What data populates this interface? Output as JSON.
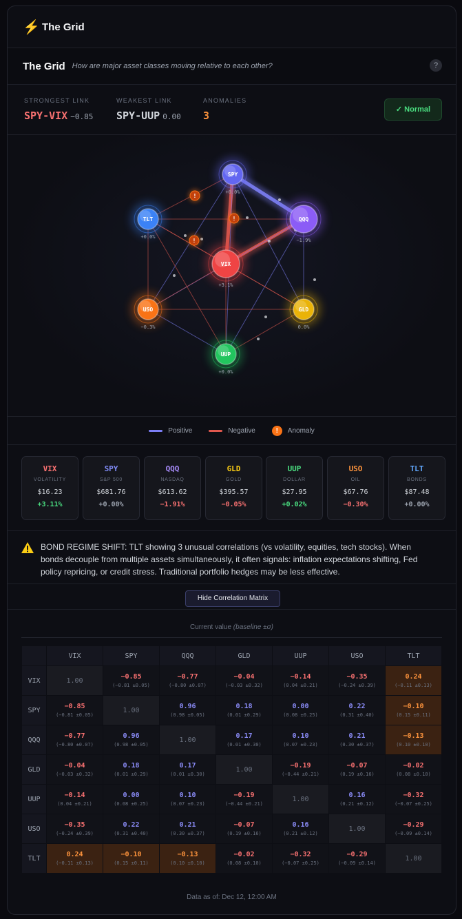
{
  "app": {
    "title": "The Grid",
    "icon": "lightning-bolt-icon"
  },
  "header": {
    "title": "The Grid",
    "subtitle": "How are major asset classes moving relative to each other?",
    "help": "?"
  },
  "stats": {
    "strongest": {
      "label": "STRONGEST LINK",
      "pair": "SPY-VIX",
      "value": "−0.85"
    },
    "weakest": {
      "label": "WEAKEST LINK",
      "pair": "SPY-UUP",
      "value": "0.00"
    },
    "anomalies": {
      "label": "ANOMALIES",
      "value": "3"
    },
    "status": "✓  Normal"
  },
  "colors": {
    "positive": "#7c7ff5",
    "negative": "#e0584e",
    "anomaly": "#f97316"
  },
  "nodes": [
    {
      "id": "SPY",
      "change": "+0.0%",
      "color": "#6366f1"
    },
    {
      "id": "QQQ",
      "change": "−1.9%",
      "color": "#8b5cf6"
    },
    {
      "id": "TLT",
      "change": "+0.0%",
      "color": "#3b82f6"
    },
    {
      "id": "VIX",
      "change": "+3.1%",
      "color": "#ef4444"
    },
    {
      "id": "USO",
      "change": "−0.3%",
      "color": "#f97316"
    },
    {
      "id": "GLD",
      "change": "0.0%",
      "color": "#eab308"
    },
    {
      "id": "UUP",
      "change": "+0.0%",
      "color": "#22c55e"
    }
  ],
  "legend": {
    "positive": "Positive",
    "negative": "Negative",
    "anomaly": "Anomaly",
    "anomaly_mark": "!"
  },
  "assets": [
    {
      "symbol": "VIX",
      "name": "VOLATILITY",
      "price": "$16.23",
      "change": "+3.11%",
      "color": "#f87171",
      "dir": "up"
    },
    {
      "symbol": "SPY",
      "name": "S&P 500",
      "price": "$681.76",
      "change": "+0.00%",
      "color": "#818cf8",
      "dir": "flat"
    },
    {
      "symbol": "QQQ",
      "name": "NASDAQ",
      "price": "$613.62",
      "change": "−1.91%",
      "color": "#a78bfa",
      "dir": "down"
    },
    {
      "symbol": "GLD",
      "name": "GOLD",
      "price": "$395.57",
      "change": "−0.05%",
      "color": "#facc15",
      "dir": "down"
    },
    {
      "symbol": "UUP",
      "name": "DOLLAR",
      "price": "$27.95",
      "change": "+0.02%",
      "color": "#4ade80",
      "dir": "up"
    },
    {
      "symbol": "USO",
      "name": "OIL",
      "price": "$67.76",
      "change": "−0.30%",
      "color": "#fb923c",
      "dir": "down"
    },
    {
      "symbol": "TLT",
      "name": "BONDS",
      "price": "$87.48",
      "change": "+0.00%",
      "color": "#60a5fa",
      "dir": "flat"
    }
  ],
  "alert": {
    "text": "BOND REGIME SHIFT: TLT showing 3 unusual correlations (vs volatility, equities, tech stocks). When bonds decouple from multiple assets simultaneously, it often signals: inflation expectations shifting, Fed policy repricing, or credit stress. Traditional portfolio hedges may be less effective."
  },
  "matrix_toggle": "Hide Correlation Matrix",
  "matrix": {
    "caption": "Current value",
    "caption_note": "(baseline ±σ)",
    "labels": [
      "VIX",
      "SPY",
      "QQQ",
      "GLD",
      "UUP",
      "USO",
      "TLT"
    ],
    "rows": [
      [
        {
          "v": "1.00",
          "d": 1
        },
        {
          "v": "−0.85",
          "b": "(−0.81 ±0.05)"
        },
        {
          "v": "−0.77",
          "b": "(−0.80 ±0.07)"
        },
        {
          "v": "−0.04",
          "b": "(−0.03 ±0.32)"
        },
        {
          "v": "−0.14",
          "b": "(0.04 ±0.21)"
        },
        {
          "v": "−0.35",
          "b": "(−0.24 ±0.39)"
        },
        {
          "v": "0.24",
          "b": "(−0.11 ±0.13)",
          "a": 1
        }
      ],
      [
        {
          "v": "−0.85",
          "b": "(−0.81 ±0.05)"
        },
        {
          "v": "1.00",
          "d": 1
        },
        {
          "v": "0.96",
          "b": "(0.98 ±0.05)"
        },
        {
          "v": "0.18",
          "b": "(0.01 ±0.29)"
        },
        {
          "v": "0.00",
          "b": "(0.08 ±0.25)"
        },
        {
          "v": "0.22",
          "b": "(0.31 ±0.40)"
        },
        {
          "v": "−0.10",
          "b": "(0.15 ±0.11)",
          "a": 1
        }
      ],
      [
        {
          "v": "−0.77",
          "b": "(−0.80 ±0.07)"
        },
        {
          "v": "0.96",
          "b": "(0.98 ±0.05)"
        },
        {
          "v": "1.00",
          "d": 1
        },
        {
          "v": "0.17",
          "b": "(0.01 ±0.30)"
        },
        {
          "v": "0.10",
          "b": "(0.07 ±0.23)"
        },
        {
          "v": "0.21",
          "b": "(0.30 ±0.37)"
        },
        {
          "v": "−0.13",
          "b": "(0.10 ±0.10)",
          "a": 1
        }
      ],
      [
        {
          "v": "−0.04",
          "b": "(−0.03 ±0.32)"
        },
        {
          "v": "0.18",
          "b": "(0.01 ±0.29)"
        },
        {
          "v": "0.17",
          "b": "(0.01 ±0.30)"
        },
        {
          "v": "1.00",
          "d": 1
        },
        {
          "v": "−0.19",
          "b": "(−0.44 ±0.21)"
        },
        {
          "v": "−0.07",
          "b": "(0.19 ±0.16)"
        },
        {
          "v": "−0.02",
          "b": "(0.08 ±0.10)"
        }
      ],
      [
        {
          "v": "−0.14",
          "b": "(0.04 ±0.21)"
        },
        {
          "v": "0.00",
          "b": "(0.08 ±0.25)"
        },
        {
          "v": "0.10",
          "b": "(0.07 ±0.23)"
        },
        {
          "v": "−0.19",
          "b": "(−0.44 ±0.21)"
        },
        {
          "v": "1.00",
          "d": 1
        },
        {
          "v": "0.16",
          "b": "(0.21 ±0.12)"
        },
        {
          "v": "−0.32",
          "b": "(−0.07 ±0.25)"
        }
      ],
      [
        {
          "v": "−0.35",
          "b": "(−0.24 ±0.39)"
        },
        {
          "v": "0.22",
          "b": "(0.31 ±0.40)"
        },
        {
          "v": "0.21",
          "b": "(0.30 ±0.37)"
        },
        {
          "v": "−0.07",
          "b": "(0.19 ±0.16)"
        },
        {
          "v": "0.16",
          "b": "(0.21 ±0.12)"
        },
        {
          "v": "1.00",
          "d": 1
        },
        {
          "v": "−0.29",
          "b": "(−0.09 ±0.14)"
        }
      ],
      [
        {
          "v": "0.24",
          "b": "(−0.11 ±0.13)",
          "a": 1
        },
        {
          "v": "−0.10",
          "b": "(0.15 ±0.11)",
          "a": 1
        },
        {
          "v": "−0.13",
          "b": "(0.10 ±0.10)",
          "a": 1
        },
        {
          "v": "−0.02",
          "b": "(0.08 ±0.10)"
        },
        {
          "v": "−0.32",
          "b": "(−0.07 ±0.25)"
        },
        {
          "v": "−0.29",
          "b": "(−0.09 ±0.14)"
        },
        {
          "v": "1.00",
          "d": 1
        }
      ]
    ]
  },
  "footer": "Data as of: Dec 12, 12:00 AM"
}
